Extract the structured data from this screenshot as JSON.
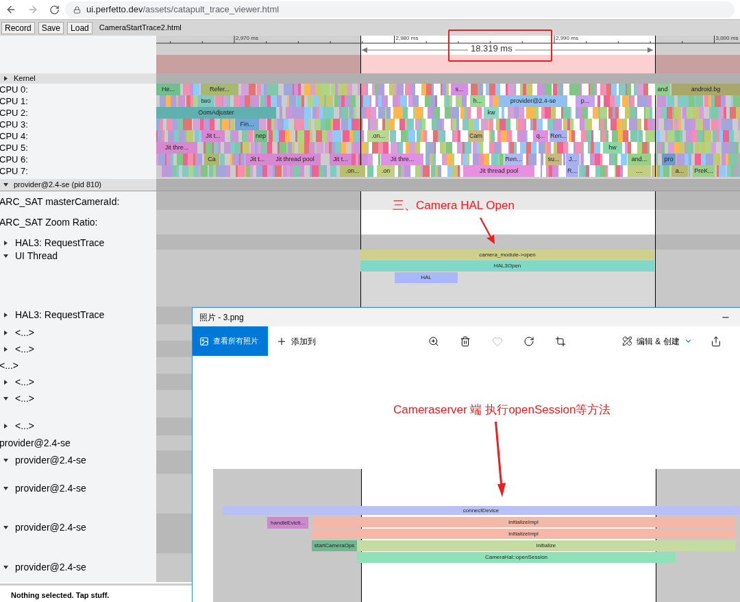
{
  "browser": {
    "url_host": "ui.perfetto.dev",
    "url_path": "/assets/catapult_trace_viewer.html"
  },
  "toolbar": {
    "buttons": [
      "Record",
      "Save",
      "Load"
    ],
    "filename": "CameraStartTrace2.html"
  },
  "ruler": {
    "ticks": [
      "2,970 ms",
      "2,980 ms",
      "2,990 ms",
      "3,000 ms"
    ],
    "selection_duration": "18.319 ms"
  },
  "kernel": {
    "label": "Kernel",
    "expanded": false
  },
  "cpus": [
    {
      "label": "CPU 0:",
      "slices": [
        {
          "label": "He...",
          "color": "#6fbf8f"
        },
        {
          "label": "Refer...",
          "color": "#a8b870"
        },
        {
          "label": "s...",
          "color": "#d88ee0"
        },
        {
          "label": "and",
          "color": "#8fcf8f"
        },
        {
          "label": "android.bg",
          "color": "#a8a868"
        }
      ]
    },
    {
      "label": "CPU 1:",
      "slices": [
        {
          "label": "two",
          "color": "#80c8c0"
        },
        {
          "label": "h...",
          "color": "#9ad89a"
        },
        {
          "label": "provider@2.4-se",
          "color": "#8fc0f0"
        },
        {
          "label": "p...",
          "color": "#c8a0f0"
        }
      ]
    },
    {
      "label": "CPU 2:",
      "slices": [
        {
          "label": "OomAdjuster",
          "color": "#60b0b0"
        },
        {
          "label": "kw",
          "color": "#8fd8c8"
        }
      ]
    },
    {
      "label": "CPU 3:",
      "slices": [
        {
          "label": "Fin...",
          "color": "#70a8d8"
        }
      ]
    },
    {
      "label": "CPU 4:",
      "slices": [
        {
          "label": "Jit t...",
          "color": "#d888d0"
        },
        {
          "label": "nep",
          "color": "#78c088"
        },
        {
          "label": ".on...",
          "color": "#b8d890"
        },
        {
          "label": "Cam",
          "color": "#c8b880"
        },
        {
          "label": "q...",
          "color": "#e090e0"
        },
        {
          "label": "Ren...",
          "color": "#a8b0f0"
        }
      ]
    },
    {
      "label": "CPU 5:",
      "slices": [
        {
          "label": "Jit thre...",
          "color": "#d888d0"
        },
        {
          "label": "hw",
          "color": "#88d8a8"
        }
      ]
    },
    {
      "label": "CPU 6:",
      "slices": [
        {
          "label": "Ca",
          "color": "#a8b870"
        },
        {
          "label": "Jit t...",
          "color": "#d888d0"
        },
        {
          "label": "Jit thread pool",
          "color": "#d888d0"
        },
        {
          "label": "Jit t...",
          "color": "#d888d0"
        },
        {
          "label": "Jit thre...",
          "color": "#e090e0"
        },
        {
          "label": "Ren...",
          "color": "#b0b8f0"
        },
        {
          "label": "su...",
          "color": "#c8b880"
        },
        {
          "label": "J...",
          "color": "#a8b0f0"
        },
        {
          "label": "and...",
          "color": "#98d088"
        },
        {
          "label": "pro",
          "color": "#7098c8"
        }
      ]
    },
    {
      "label": "CPU 7:",
      "slices": [
        {
          "label": ".on...",
          "color": "#b8c070"
        },
        {
          "label": ".on",
          "color": "#c0d080"
        },
        {
          "label": "Jit thread pool",
          "color": "#e890e0"
        },
        {
          "label": "R...",
          "color": "#a8b0f0"
        },
        {
          "label": "....",
          "color": "#c0d080"
        },
        {
          "label": "a...",
          "color": "#b8b870"
        },
        {
          "label": "PreK...",
          "color": "#98d088"
        }
      ]
    }
  ],
  "process": {
    "label": "provider@2.4-se (pid 810)",
    "expanded": true
  },
  "tracks": [
    {
      "kind": "plain",
      "label": "ARC_SAT masterCameraId:"
    },
    {
      "kind": "plain",
      "label": "ARC_SAT Zoom Ratio:"
    },
    {
      "kind": "node",
      "label": "HAL3: RequestTrace",
      "expanded": false
    },
    {
      "kind": "node",
      "label": "UI Thread",
      "expanded": true,
      "slices": [
        {
          "label": "camera_module->open",
          "color": "#d0d08e"
        },
        {
          "label": "HAL3Open",
          "color": "#80d8c8"
        },
        {
          "label": "HAL",
          "color": "#a8b8f8"
        }
      ]
    },
    {
      "kind": "node",
      "label": "HAL3: RequestTrace",
      "expanded": false
    },
    {
      "kind": "node",
      "label": "<...>",
      "expanded": false
    },
    {
      "kind": "node",
      "label": "<...>",
      "expanded": false
    },
    {
      "kind": "plain",
      "label": "<...>"
    },
    {
      "kind": "node",
      "label": "<...>",
      "expanded": false
    },
    {
      "kind": "node",
      "label": "<...>",
      "expanded": true
    },
    {
      "kind": "node",
      "label": "<...>",
      "expanded": false
    },
    {
      "kind": "plain",
      "label": "provider@2.4-se"
    },
    {
      "kind": "node",
      "label": "provider@2.4-se",
      "expanded": true
    },
    {
      "kind": "node",
      "label": "provider@2.4-se",
      "expanded": true
    },
    {
      "kind": "node",
      "label": "provider@2.4-se",
      "expanded": true
    },
    {
      "kind": "node",
      "label": "provider@2.4-se",
      "expanded": true
    }
  ],
  "annotation": "三、Camera HAL Open",
  "photos_window": {
    "title": "照片 - 3.png",
    "view_all": "查看所有照片",
    "add_to": "添加到",
    "favorite": false,
    "edit_create": "编辑 & 创建",
    "annotation": "Cameraserver 端 执行openSession等方法",
    "image_slices": [
      {
        "label": "connectDevice",
        "color": "#b8c0f8"
      },
      {
        "label": "handleEvicti...",
        "color": "#cc88cc"
      },
      {
        "label": "initializeImpl",
        "color": "#f4b8a8"
      },
      {
        "label": "initializeImpl",
        "color": "#f4b8a8"
      },
      {
        "label": "startCameraOps",
        "color": "#70b890"
      },
      {
        "label": "initialize",
        "color": "#c4dca0"
      },
      {
        "label": "CameraHal::openSession",
        "color": "#90e0b8"
      }
    ]
  },
  "status": "Nothing selected. Tap stuff."
}
